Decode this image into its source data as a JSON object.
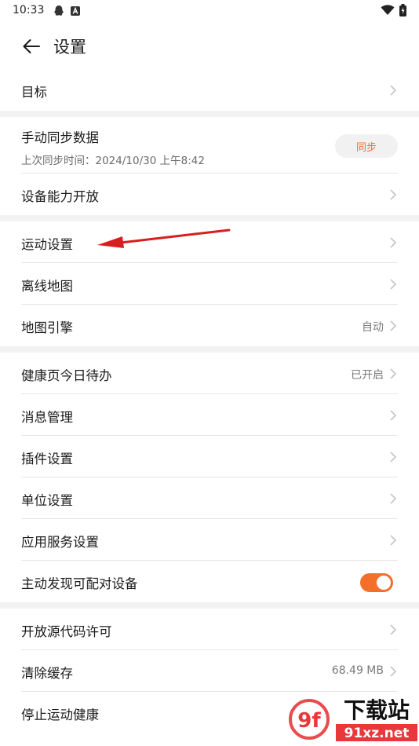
{
  "status_bar": {
    "time": "10:33",
    "left_icons": [
      "qq-icon",
      "a-badge-icon"
    ],
    "right_icons": [
      "wifi-icon",
      "battery-icon"
    ]
  },
  "header": {
    "title": "设置"
  },
  "groups": [
    {
      "rows": [
        {
          "label": "目标",
          "chevron": true
        }
      ]
    },
    {
      "rows": [
        {
          "label": "手动同步数据",
          "sub": "上次同步时间：2024/10/30 上午8:42",
          "button": "同步"
        },
        {
          "label": "设备能力开放",
          "chevron": true
        }
      ]
    },
    {
      "rows": [
        {
          "label": "运动设置",
          "chevron": true
        },
        {
          "label": "离线地图",
          "chevron": true
        },
        {
          "label": "地图引擎",
          "value": "自动",
          "chevron": true
        }
      ]
    },
    {
      "rows": [
        {
          "label": "健康页今日待办",
          "value": "已开启",
          "chevron": true
        },
        {
          "label": "消息管理",
          "chevron": true
        },
        {
          "label": "插件设置",
          "chevron": true
        },
        {
          "label": "单位设置",
          "chevron": true
        },
        {
          "label": "应用服务设置",
          "chevron": true
        },
        {
          "label": "主动发现可配对设备",
          "toggle": true
        }
      ]
    },
    {
      "rows": [
        {
          "label": "开放源代码许可",
          "chevron": true
        },
        {
          "label": "清除缓存",
          "value": "68.49 MB",
          "chevron": true
        },
        {
          "label": "停止运动健康",
          "chevron": true
        }
      ]
    }
  ],
  "watermark": {
    "logo_text": "9f",
    "brand_text": "下载站",
    "domain_text": "91xz.net"
  },
  "colors": {
    "accent": "#f36f2a",
    "annotation_arrow": "#d81e1e",
    "group_gap": "#f2f2f2"
  }
}
